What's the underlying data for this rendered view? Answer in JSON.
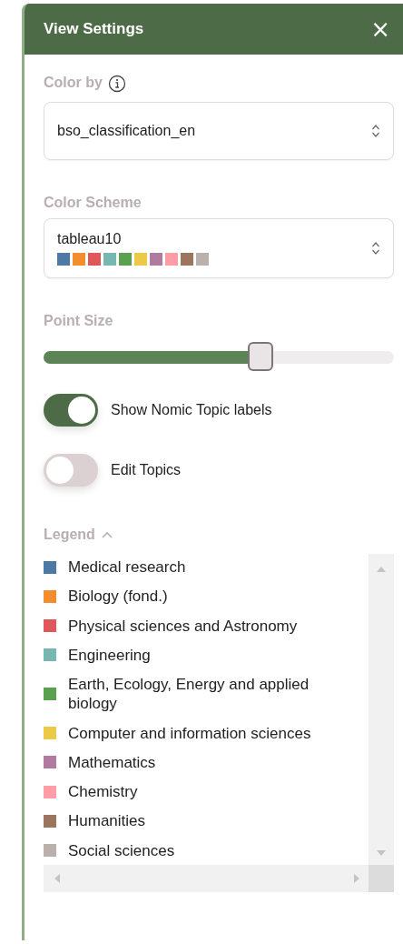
{
  "window": {
    "title": "View Settings",
    "close": "×"
  },
  "color_by": {
    "label": "Color by",
    "value": "bso_classification_en"
  },
  "color_scheme": {
    "label": "Color Scheme",
    "value": "tableau10",
    "swatches": [
      {
        "color": "#4e79a7"
      },
      {
        "color": "#f28e2b"
      },
      {
        "color": "#e15759"
      },
      {
        "color": "#76b7b2"
      },
      {
        "color": "#59a14f"
      },
      {
        "color": "#edc948"
      },
      {
        "color": "#b07aa1"
      },
      {
        "color": "#ff9da7"
      },
      {
        "color": "#9c755f"
      },
      {
        "color": "#bab0ac"
      }
    ]
  },
  "point_size": {
    "label": "Point Size",
    "level": 0.62
  },
  "toggles": [
    {
      "label": "Show Nomic Topic labels",
      "on": true
    },
    {
      "label": "Edit Topics",
      "on": false
    }
  ],
  "legend": {
    "title": "Legend",
    "expanded": true,
    "items": [
      {
        "label": "Medical research",
        "color": "#4e79a7"
      },
      {
        "label": "Biology (fond.)",
        "color": "#f28e2b"
      },
      {
        "label": "Physical sciences and Astronomy",
        "color": "#e15759"
      },
      {
        "label": "Engineering",
        "color": "#76b7b2"
      },
      {
        "label": "Earth, Ecology, Energy and applied biology",
        "color": "#59a14f"
      },
      {
        "label": "Computer and information sciences",
        "color": "#edc948"
      },
      {
        "label": "Mathematics",
        "color": "#b07aa1"
      },
      {
        "label": "Chemistry",
        "color": "#ff9da7"
      },
      {
        "label": "Humanities",
        "color": "#9c755f"
      },
      {
        "label": "Social sciences",
        "color": "#bab0ac"
      }
    ]
  }
}
